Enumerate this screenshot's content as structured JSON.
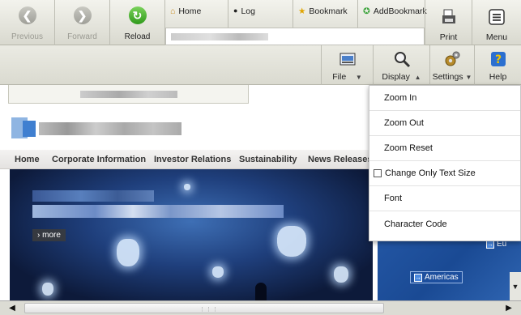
{
  "toolbar": {
    "previous_label": "Previous",
    "forward_label": "Forward",
    "reload_label": "Reload",
    "tabs": [
      {
        "icon": "home-icon",
        "label": "Home"
      },
      {
        "icon": "log-icon",
        "label": "Log"
      },
      {
        "icon": "bookmark-icon",
        "label": "Bookmark"
      },
      {
        "icon": "add-bookmark-icon",
        "label": "AddBookmark"
      }
    ],
    "print_label": "Print",
    "menu_label": "Menu"
  },
  "tools": {
    "file_label": "File",
    "display_label": "Display",
    "settings_label": "Settings",
    "help_label": "Help"
  },
  "page": {
    "nav": [
      "Home",
      "Corporate Information",
      "Investor Relations",
      "Sustainability",
      "News Releases"
    ],
    "hero_more": "› more",
    "map_europe": "Eu",
    "map_americas": "Americas"
  },
  "display_menu": {
    "items": [
      "Zoom In",
      "Zoom Out",
      "Zoom Reset",
      "Change Only Text Size",
      "Font",
      "Character Code"
    ]
  },
  "colors": {
    "toolbar_bg": "#e6e6dc",
    "reload_green": "#2f9a1b",
    "map_blue": "#1a4a94"
  }
}
